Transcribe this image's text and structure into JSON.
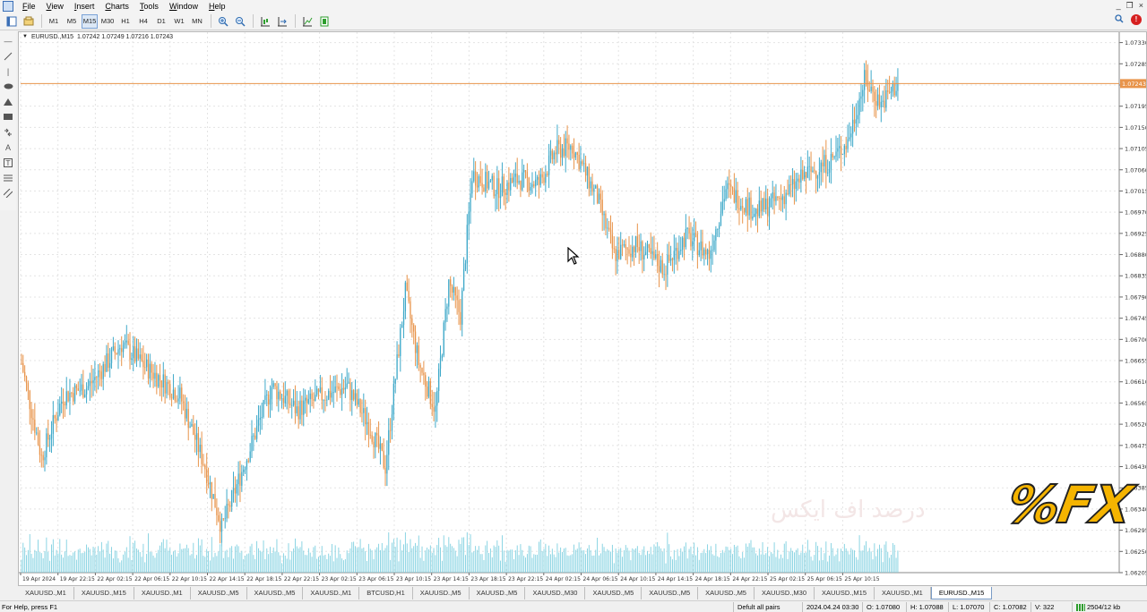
{
  "menu": {
    "items": [
      "File",
      "View",
      "Insert",
      "Charts",
      "Tools",
      "Window",
      "Help"
    ],
    "window_controls": [
      "_",
      "❐",
      "×"
    ]
  },
  "toolbar": {
    "timeframes": [
      "M1",
      "M5",
      "M15",
      "M30",
      "H1",
      "H4",
      "D1",
      "W1",
      "MN"
    ],
    "active_timeframe": "M15"
  },
  "chart": {
    "symbol": "EURUSD.,M15",
    "ohlc": "1.07242 1.07249 1.07216 1.07243",
    "current_price": "1.07243",
    "colors": {
      "bull": "#3fa9c9",
      "bear": "#e8944b",
      "price_line": "#e8944b",
      "volume": "#7fd0e0",
      "grid": "#e4e4e4"
    }
  },
  "chart_data": {
    "type": "candlestick",
    "symbol": "EURUSD.",
    "timeframe": "M15",
    "y_ticks": [
      "1.07330",
      "1.07285",
      "1.07240",
      "1.07195",
      "1.07150",
      "1.07105",
      "1.07060",
      "1.07015",
      "1.06970",
      "1.06925",
      "1.06880",
      "1.06835",
      "1.06790",
      "1.06745",
      "1.06700",
      "1.06655",
      "1.06610",
      "1.06565",
      "1.06520",
      "1.06475",
      "1.06430",
      "1.06385",
      "1.06340",
      "1.06295",
      "1.06250",
      "1.06205"
    ],
    "ylim": [
      1.06205,
      1.07352
    ],
    "x_ticks": [
      "19 Apr 2024",
      "19 Apr 22:15",
      "22 Apr 02:15",
      "22 Apr 06:15",
      "22 Apr 10:15",
      "22 Apr 14:15",
      "22 Apr 18:15",
      "22 Apr 22:15",
      "23 Apr 02:15",
      "23 Apr 06:15",
      "23 Apr 10:15",
      "23 Apr 14:15",
      "23 Apr 18:15",
      "23 Apr 22:15",
      "24 Apr 02:15",
      "24 Apr 06:15",
      "24 Apr 10:15",
      "24 Apr 14:15",
      "24 Apr 18:15",
      "24 Apr 22:15",
      "25 Apr 02:15",
      "25 Apr 06:15",
      "25 Apr 10:15"
    ],
    "anchors": [
      [
        0,
        1.0665
      ],
      [
        12,
        1.0645
      ],
      [
        25,
        1.0658
      ],
      [
        40,
        1.066
      ],
      [
        60,
        1.0669
      ],
      [
        75,
        1.0664
      ],
      [
        95,
        1.0658
      ],
      [
        110,
        1.0643
      ],
      [
        120,
        1.063
      ],
      [
        135,
        1.0645
      ],
      [
        150,
        1.066
      ],
      [
        165,
        1.0655
      ],
      [
        180,
        1.0658
      ],
      [
        195,
        1.066
      ],
      [
        208,
        1.0652
      ],
      [
        218,
        1.0643
      ],
      [
        224,
        1.0662
      ],
      [
        230,
        1.068
      ],
      [
        238,
        1.0665
      ],
      [
        248,
        1.0655
      ],
      [
        256,
        1.0682
      ],
      [
        263,
        1.0675
      ],
      [
        270,
        1.0705
      ],
      [
        285,
        1.0702
      ],
      [
        298,
        1.0704
      ],
      [
        310,
        1.0703
      ],
      [
        320,
        1.071
      ],
      [
        330,
        1.0711
      ],
      [
        345,
        1.07
      ],
      [
        355,
        1.0688
      ],
      [
        368,
        1.069
      ],
      [
        385,
        1.0685
      ],
      [
        398,
        1.0692
      ],
      [
        412,
        1.0688
      ],
      [
        422,
        1.0702
      ],
      [
        440,
        1.0697
      ],
      [
        455,
        1.07
      ],
      [
        470,
        1.0705
      ],
      [
        485,
        1.0708
      ],
      [
        495,
        1.0712
      ],
      [
        505,
        1.0725
      ],
      [
        515,
        1.072
      ],
      [
        525,
        1.07243
      ]
    ]
  },
  "tabs": [
    "XAUUSD.,M1",
    "XAUUSD.,M15",
    "XAUUSD.,M1",
    "XAUUSD.,M5",
    "XAUUSD.,M5",
    "XAUUSD.,M1",
    "BTCUSD,H1",
    "XAUUSD.,M5",
    "XAUUSD.,M5",
    "XAUUSD.,M30",
    "XAUUSD.,M5",
    "XAUUSD.,M5",
    "XAUUSD.,M5",
    "XAUUSD.,M30",
    "XAUUSD.,M15",
    "XAUUSD.,M1",
    "EURUSD.,M15"
  ],
  "active_tab": "EURUSD.,M15",
  "status": {
    "help": "For Help, press F1",
    "profile": "Defult all pairs",
    "datetime": "2024.04.24 03:30",
    "open": "O: 1.07080",
    "high": "H: 1.07088",
    "low": "L: 1.07070",
    "close": "C: 1.07082",
    "volume": "V: 322",
    "traffic": "2504/12 kb"
  },
  "watermark": {
    "logo_text": "%FX",
    "arabic_text": "درصد اف ایکس"
  }
}
